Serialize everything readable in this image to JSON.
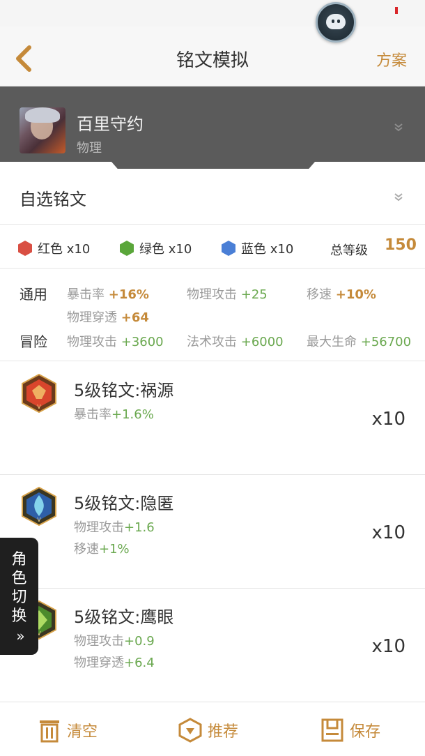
{
  "nav": {
    "title": "铭文模拟",
    "plan_label": "方案"
  },
  "hero": {
    "name": "百里守约",
    "type": "物理"
  },
  "selection": {
    "label": "自选铭文"
  },
  "colors": {
    "red": {
      "label": "红色 x10",
      "color": "#d94f43"
    },
    "green": {
      "label": "绿色 x10",
      "color": "#5aa63a"
    },
    "blue": {
      "label": "蓝色 x10",
      "color": "#4a7fd6"
    },
    "total_label": "总等级",
    "total_value": "150"
  },
  "stats": {
    "general_label": "通用",
    "general": [
      {
        "name": "暴击率",
        "value": "+16%"
      },
      {
        "name": "物理攻击",
        "value": "+25"
      },
      {
        "name": "移速",
        "value": "+10%"
      },
      {
        "name": "物理穿透",
        "value": "+64"
      }
    ],
    "adventure_label": "冒险",
    "adventure": [
      {
        "name": "物理攻击",
        "value": "+3600"
      },
      {
        "name": "法术攻击",
        "value": "+6000"
      },
      {
        "name": "最大生命",
        "value": "+56700"
      }
    ]
  },
  "inscriptions": [
    {
      "title": "5级铭文:祸源",
      "icon": "red-inscription-icon",
      "attrs": [
        {
          "name": "暴击率",
          "value": "+1.6%"
        }
      ],
      "count": "x10"
    },
    {
      "title": "5级铭文:隐匿",
      "icon": "blue-inscription-icon",
      "attrs": [
        {
          "name": "物理攻击",
          "value": "+1.6"
        },
        {
          "name": "移速",
          "value": "+1%"
        }
      ],
      "count": "x10"
    },
    {
      "title": "5级铭文:鹰眼",
      "icon": "green-inscription-icon",
      "attrs": [
        {
          "name": "物理攻击",
          "value": "+0.9"
        },
        {
          "name": "物理穿透",
          "value": "+6.4"
        }
      ],
      "count": "x10"
    }
  ],
  "side_tab": {
    "chars": [
      "角",
      "色",
      "切",
      "换"
    ],
    "arrows": "»"
  },
  "bottom": {
    "clear": "清空",
    "recommend": "推荐",
    "save": "保存"
  },
  "accent": "#c58a3a"
}
